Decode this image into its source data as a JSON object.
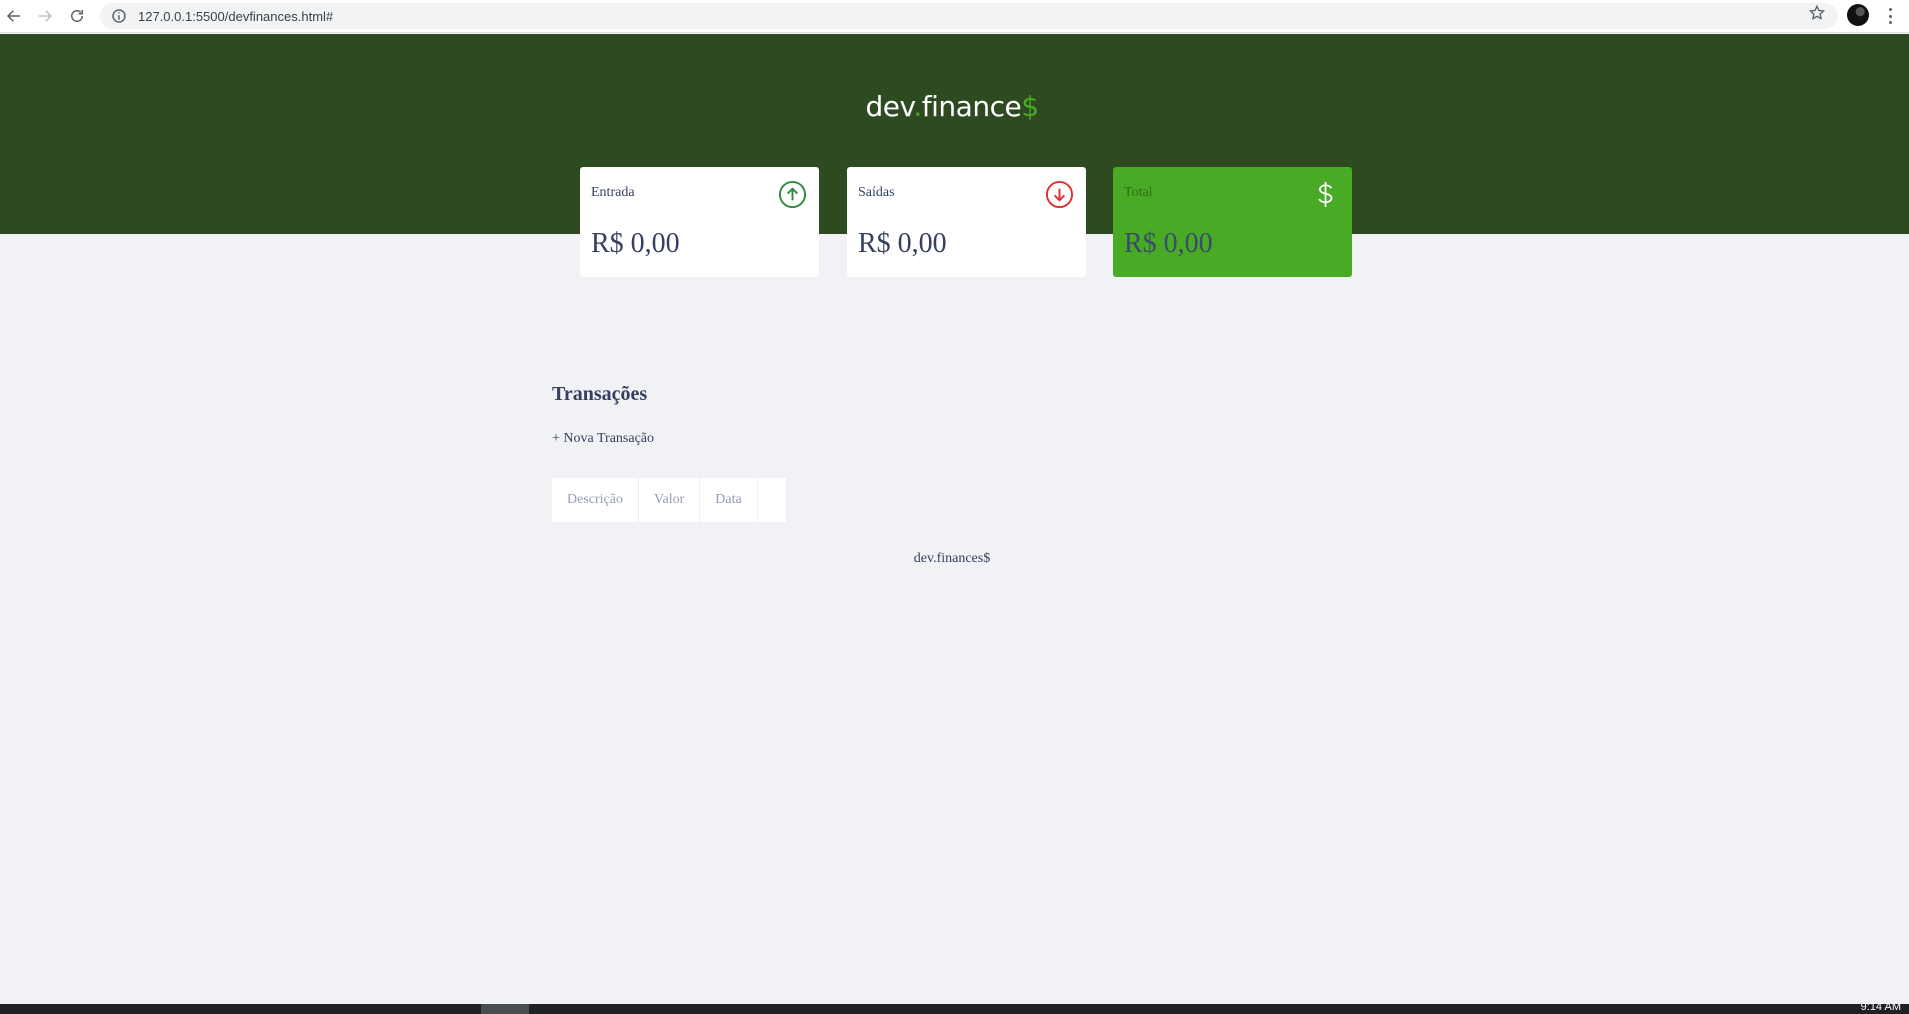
{
  "browser": {
    "url": "127.0.0.1:5500/devfinances.html#",
    "icons": {
      "back": "arrow-left-icon",
      "forward": "arrow-right-icon",
      "reload": "reload-icon",
      "info": "info-icon",
      "star": "star-icon",
      "profile": "profile-avatar",
      "menu": "kebab-menu-icon"
    }
  },
  "header": {
    "logo_dev": "dev",
    "logo_dot": ".",
    "logo_finance": "finance",
    "logo_dollar": "$",
    "colors": {
      "background": "#2d4a21",
      "accent": "#49aa26"
    }
  },
  "cards": [
    {
      "label": "Entrada",
      "value": "R$ 0,00",
      "icon": "arrow-up-circle-icon",
      "icon_color": "#2f8a3f"
    },
    {
      "label": "Saídas",
      "value": "R$ 0,00",
      "icon": "arrow-down-circle-icon",
      "icon_color": "#e02f2f"
    },
    {
      "label": "Total",
      "value": "R$ 0,00",
      "icon": "dollar-sign-icon",
      "background": "#49aa26"
    }
  ],
  "transactions": {
    "title": "Transações",
    "new_button": "+ Nova Transação",
    "columns": [
      "Descrição",
      "Valor",
      "Data",
      ""
    ]
  },
  "footer": {
    "text": "dev.finances$"
  },
  "taskbar": {
    "clock": "9:14 AM"
  }
}
